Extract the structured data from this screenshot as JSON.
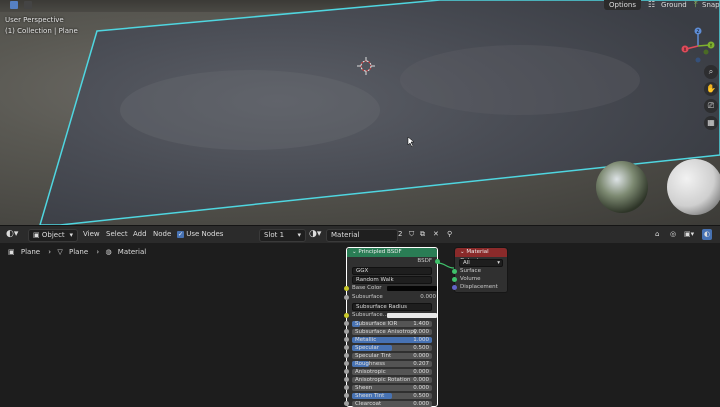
{
  "viewport": {
    "top_buttons": {
      "options": "Options",
      "ground": "Ground",
      "snap": "Snap"
    },
    "info_line1": "User Perspective",
    "info_line2": "(1) Collection | Plane",
    "gizmo": {
      "x": "X",
      "y": "Y",
      "z": "Z"
    },
    "colors": {
      "plane_outline": "#4fd6e0",
      "world_bg": "#5a5953"
    }
  },
  "header": {
    "editor_type_icon": "node-editor-icon",
    "mode": "Object",
    "menus": [
      "View",
      "Select",
      "Add",
      "Node"
    ],
    "use_nodes_label": "Use Nodes",
    "use_nodes_checked": true,
    "slot": "Slot 1",
    "material_name": "Material",
    "user_count": "2"
  },
  "breadcrumb": [
    "Plane",
    "Plane",
    "Material"
  ],
  "principled": {
    "title": "Principled BSDF",
    "output": "BSDF",
    "distribution": "GGX",
    "subsurface_method": "Random Walk",
    "base_color_label": "Base Color",
    "subsurface": {
      "label": "Subsurface",
      "value": "0.000"
    },
    "subsurface_radius": "Subsurface Radius",
    "subsurface_color": "Subsurface...",
    "params": [
      {
        "label": "Subsurface IOR",
        "value": "1.400",
        "fill": 0.1
      },
      {
        "label": "Subsurface Anisotropy",
        "value": "0.000",
        "fill": 0
      },
      {
        "label": "Metallic",
        "value": "1.000",
        "fill": 1.0
      },
      {
        "label": "Specular",
        "value": "0.500",
        "fill": 0.5
      },
      {
        "label": "Specular Tint",
        "value": "0.000",
        "fill": 0
      },
      {
        "label": "Roughness",
        "value": "0.207",
        "fill": 0.207
      },
      {
        "label": "Anisotropic",
        "value": "0.000",
        "fill": 0
      },
      {
        "label": "Anisotropic Rotation",
        "value": "0.000",
        "fill": 0
      },
      {
        "label": "Sheen",
        "value": "0.000",
        "fill": 0
      },
      {
        "label": "Sheen Tint",
        "value": "0.500",
        "fill": 0.5
      },
      {
        "label": "Clearcoat",
        "value": "0.000",
        "fill": 0
      }
    ]
  },
  "material_output": {
    "title": "Material Output",
    "target": "All",
    "sockets": [
      "Surface",
      "Volume",
      "Displacement"
    ]
  }
}
